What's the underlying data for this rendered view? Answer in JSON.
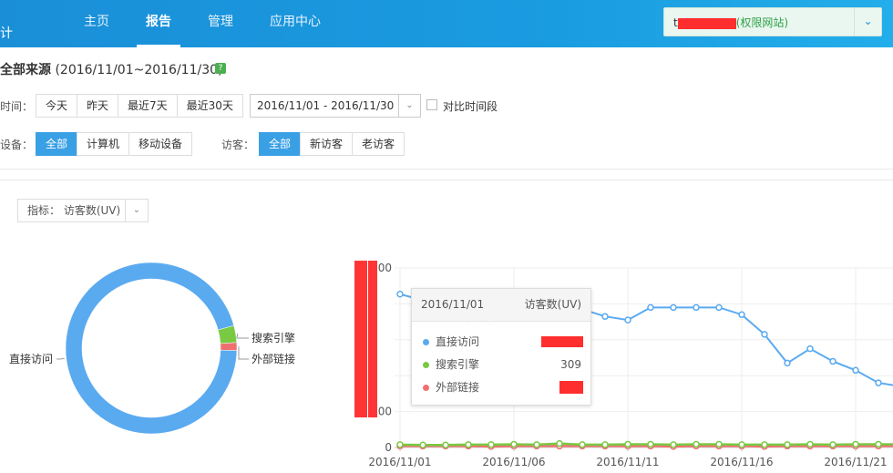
{
  "brand": "计",
  "nav": {
    "items": [
      "主页",
      "报告",
      "管理",
      "应用中心"
    ],
    "active": 1
  },
  "site": {
    "prefix": "t",
    "permission": "(权限网站)"
  },
  "page": {
    "title_bold": "全部来源",
    "range": "(2016/11/01~2016/11/30)",
    "help": "?"
  },
  "time_filter": {
    "label": "时间：",
    "options": [
      "今天",
      "昨天",
      "最近7天",
      "最近30天"
    ],
    "date_range": "2016/11/01 - 2016/11/30",
    "compare_label": "对比时间段"
  },
  "device_filter": {
    "label": "设备：",
    "options": [
      "全部",
      "计算机",
      "移动设备"
    ],
    "selected": 0
  },
  "visitor_filter": {
    "label": "访客：",
    "options": [
      "全部",
      "新访客",
      "老访客"
    ],
    "selected": 0
  },
  "metric": {
    "label": "指标：",
    "value": "访客数(UV)"
  },
  "colors": {
    "direct": "#5aaaf0",
    "search": "#7ac943",
    "external": "#f07070",
    "redact": "#ff2e2e"
  },
  "chart_data": [
    {
      "type": "pie",
      "style": "donut",
      "categories": [
        "直接访问",
        "搜索引擎",
        "外部链接"
      ],
      "values": [
        95.3,
        3.2,
        1.5
      ]
    },
    {
      "type": "line",
      "x_ticks": [
        "2016/11/01",
        "2016/11/06",
        "2016/11/11",
        "2016/11/16",
        "2016/11/21"
      ],
      "y_ticks": [
        "0",
        "100",
        "",
        "",
        "",
        "00"
      ],
      "ylim": [
        0,
        500
      ],
      "x": [
        "2016/11/01",
        "2016/11/02",
        "2016/11/03",
        "2016/11/04",
        "2016/11/05",
        "2016/11/06",
        "2016/11/07",
        "2016/11/08",
        "2016/11/09",
        "2016/11/10",
        "2016/11/11",
        "2016/11/12",
        "2016/11/13",
        "2016/11/14",
        "2016/11/15",
        "2016/11/16",
        "2016/11/17",
        "2016/11/18",
        "2016/11/19",
        "2016/11/20",
        "2016/11/21",
        "2016/11/22",
        "2016/11/23"
      ],
      "series": [
        {
          "name": "直接访问",
          "values": [
            427,
            410,
            385,
            355,
            350,
            430,
            425,
            405,
            385,
            365,
            355,
            390,
            390,
            390,
            390,
            370,
            315,
            235,
            275,
            240,
            215,
            180,
            170
          ]
        },
        {
          "name": "搜索引擎",
          "values": [
            8,
            7,
            7,
            8,
            8,
            9,
            8,
            11,
            8,
            8,
            9,
            9,
            8,
            9,
            9,
            8,
            8,
            8,
            9,
            8,
            9,
            9,
            9
          ]
        },
        {
          "name": "外部链接",
          "values": [
            4,
            4,
            4,
            4,
            3,
            4,
            4,
            4,
            4,
            4,
            4,
            4,
            3,
            4,
            4,
            4,
            3,
            4,
            4,
            4,
            4,
            4,
            4
          ]
        }
      ]
    }
  ],
  "tooltip": {
    "date": "2016/11/01",
    "metric": "访客数(UV)",
    "rows": [
      {
        "name": "直接访问",
        "value": ""
      },
      {
        "name": "搜索引擎",
        "value": "309"
      },
      {
        "name": "外部链接",
        "value": ""
      }
    ]
  }
}
